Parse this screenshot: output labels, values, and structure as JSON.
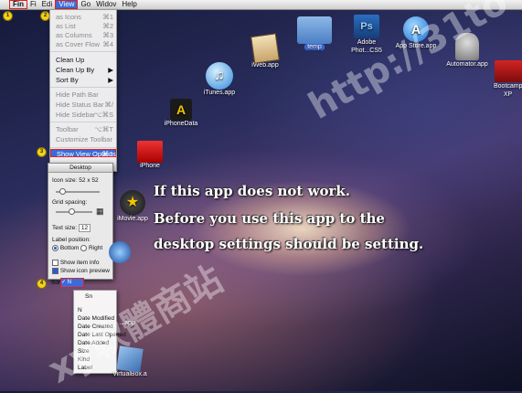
{
  "menubar": {
    "apple_symbol": "",
    "items": [
      "Fin",
      "Fi",
      "Edi",
      "View",
      "Go",
      "Widov",
      "Help"
    ]
  },
  "badges": [
    "1",
    "2",
    "3",
    "4"
  ],
  "view_menu": {
    "items": [
      {
        "label": "as Icons",
        "shortcut": "⌘1",
        "disabled": true
      },
      {
        "label": "as List",
        "shortcut": "⌘2",
        "disabled": true
      },
      {
        "label": "as Columns",
        "shortcut": "⌘3",
        "disabled": true
      },
      {
        "label": "as Cover Flow",
        "shortcut": "⌘4",
        "disabled": true
      },
      {
        "label": "Clean Up",
        "shortcut": "",
        "disabled": false
      },
      {
        "label": "Clean Up By",
        "shortcut": "▶",
        "disabled": false
      },
      {
        "label": "Sort By",
        "shortcut": "▶",
        "disabled": false
      },
      {
        "label": "Hide Path Bar",
        "shortcut": "",
        "disabled": true
      },
      {
        "label": "Hide Status Bar",
        "shortcut": "⌘/",
        "disabled": true
      },
      {
        "label": "Hide Sidebar",
        "shortcut": "⌥⌘S",
        "disabled": true
      },
      {
        "label": "Toolbar",
        "shortcut": "⌥⌘T",
        "disabled": true
      },
      {
        "label": "Customize Toolbar",
        "shortcut": "",
        "disabled": true
      },
      {
        "label": "Show View Options",
        "shortcut": "⌘J",
        "disabled": false
      }
    ]
  },
  "panel": {
    "title": "Desktop",
    "icon_size_label": "Icon size:",
    "icon_size_value": "52 x 52",
    "grid_spacing_label": "Grid spacing:",
    "text_size_label": "Text size:",
    "text_size_value": "12",
    "label_position_label": "Label position:",
    "label_bottom": "Bottom",
    "label_right": "Right",
    "show_item_info": "Show item info",
    "show_icon_preview": "Show icon preview",
    "sort_by_label": "Sort by:",
    "sort_by_value": "✓ N"
  },
  "sort_list": [
    "Sn",
    "N",
    "Date Modified",
    "Date Created",
    "Date Last Opened",
    "Date Added",
    "Size",
    "Kind",
    "Label"
  ],
  "desktop_icons": [
    {
      "label": "iWeb.app",
      "name": "iweb-icon"
    },
    {
      "label": "temp",
      "name": "folder-icon"
    },
    {
      "label": "Adobe Phot...CS5",
      "name": "photoshop-icon"
    },
    {
      "label": "App Store.app",
      "name": "app-store-icon"
    },
    {
      "label": "Automator.app",
      "name": "automator-icon"
    },
    {
      "label": "iTunes.app",
      "name": "itunes-icon"
    },
    {
      "label": "Bootcamp XP",
      "name": "bootcamp-icon"
    },
    {
      "label": "iPhoneData",
      "name": "iphonedata-icon"
    },
    {
      "label": "iPhone",
      "name": "iphone-folder-icon"
    },
    {
      "label": "iMovie.app",
      "name": "imovie-icon"
    },
    {
      "label": "VirtualBox.a",
      "name": "virtualbox-icon"
    },
    {
      "label": "...app",
      "name": "app-icon"
    }
  ],
  "notes": {
    "line1": "If this app does not work.",
    "line2": "Before you use this app to the",
    "line3": "desktop settings should be setting."
  },
  "watermark": {
    "url": "http://31to",
    "cjk": "xy軟體商站"
  },
  "colors": {
    "highlight": "#3b6bd8",
    "callout_red": "#e02020",
    "badge_yellow": "#f2d21a"
  }
}
